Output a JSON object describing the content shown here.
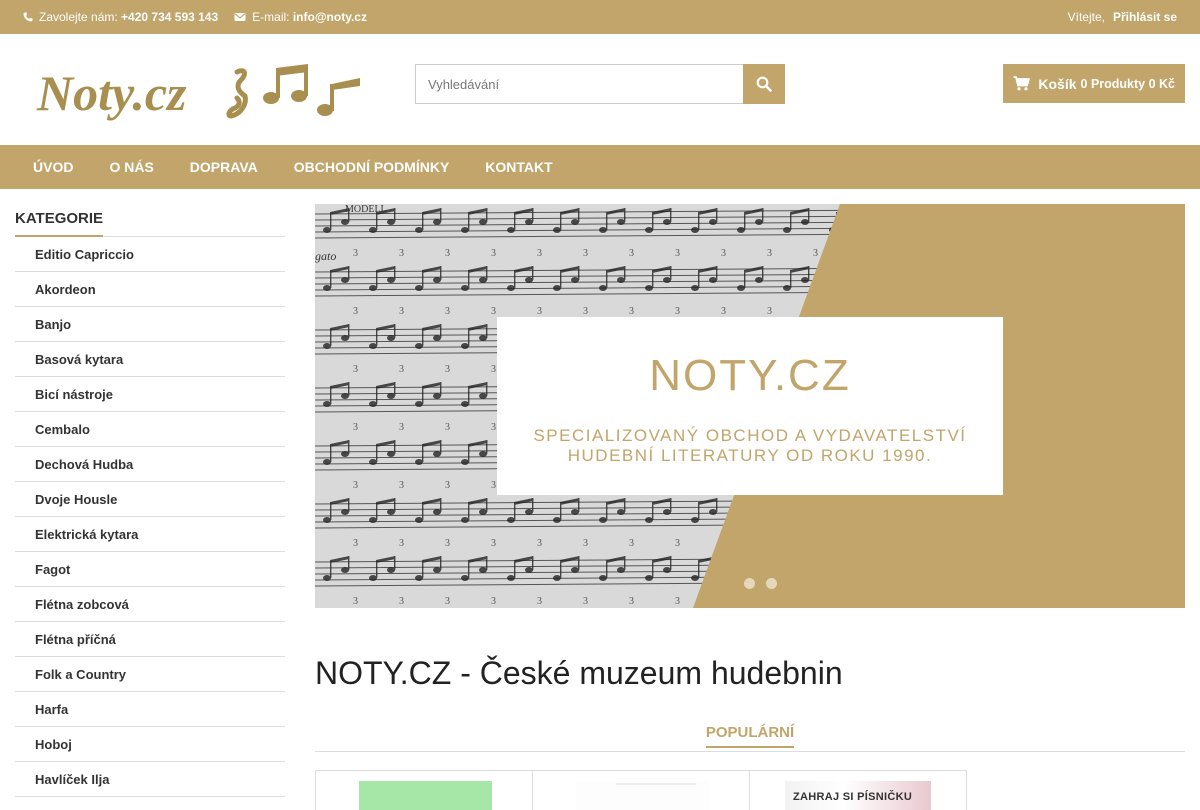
{
  "topbar": {
    "phone_label": "Zavolejte nám:",
    "phone": "+420 734 593 143",
    "email_label": "E-mail:",
    "email": "info@noty.cz",
    "welcome": "Vítejte,",
    "login": "Přihlásit se"
  },
  "header": {
    "logo_text": "Noty.cz",
    "search_placeholder": "Vyhledávání",
    "cart_label": "Košík",
    "cart_info": "0 Produkty 0 Kč"
  },
  "nav": [
    "ÚVOD",
    "O NÁS",
    "DOPRAVA",
    "OBCHODNÍ PODMÍNKY",
    "KONTAKT"
  ],
  "sidebar": {
    "title": "Kategorie",
    "items": [
      "Editio Capriccio",
      "Akordeon",
      "Banjo",
      "Basová kytara",
      "Bicí nástroje",
      "Cembalo",
      "Dechová Hudba",
      "Dvoje Housle",
      "Elektrická kytara",
      "Fagot",
      "Flétna zobcová",
      "Flétna příčná",
      "Folk a Country",
      "Harfa",
      "Hoboj",
      "Havlíček Ilja"
    ]
  },
  "banner": {
    "brand": "NOTY.CZ",
    "line1": "SPECIALIZOVANÝ OBCHOD A VYDAVATELSTVÍ",
    "line2": "HUDEBNÍ LITERATURY OD ROKU 1990.",
    "score_mark": "MODELL",
    "tempo_mark": "gato"
  },
  "main": {
    "headline": "NOTY.CZ - České muzeum hudebnin",
    "tab_popular": "Populární",
    "product3_title": "ZAHRAJ SI PÍSNIČKU"
  },
  "colors": {
    "accent": "#c2a56a",
    "banner_gold": "#c2a56a",
    "text": "#333333"
  },
  "icons": {
    "phone": "phone-icon",
    "email": "envelope-icon",
    "search": "search-icon",
    "cart": "cart-icon"
  }
}
